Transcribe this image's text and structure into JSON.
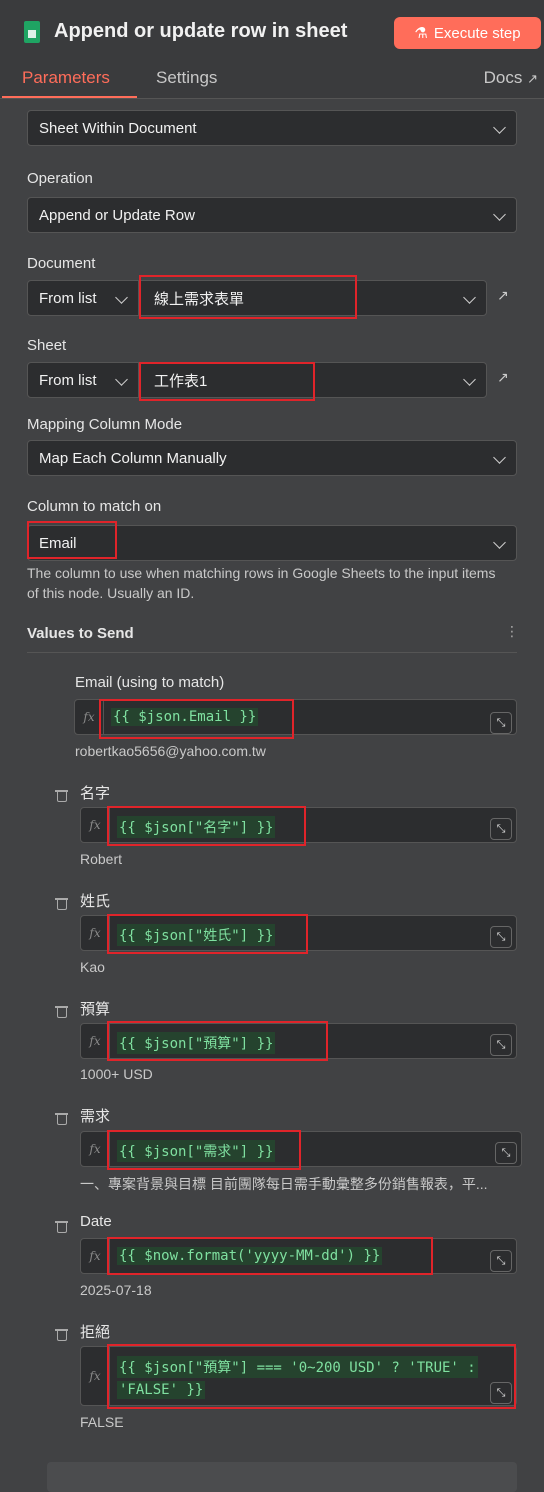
{
  "header": {
    "title": "Append or update row in sheet",
    "execute_label": "Execute step",
    "icon": "google-sheets-icon"
  },
  "tabs": {
    "parameters": "Parameters",
    "settings": "Settings",
    "docs": "Docs"
  },
  "fields": {
    "sheet_within_doc": {
      "value": "Sheet Within Document"
    },
    "operation": {
      "label": "Operation",
      "value": "Append or Update Row"
    },
    "document": {
      "label": "Document",
      "mode": "From list",
      "value": "線上需求表單"
    },
    "sheet": {
      "label": "Sheet",
      "mode": "From list",
      "value": "工作表1"
    },
    "mapping_mode": {
      "label": "Mapping Column Mode",
      "value": "Map Each Column Manually"
    },
    "column_match": {
      "label": "Column to match on",
      "value": "Email",
      "hint": "The column to use when matching rows in Google Sheets to the input items of this node. Usually an ID."
    }
  },
  "values_section": {
    "title": "Values to Send",
    "items": [
      {
        "label": "Email (using to match)",
        "expr": "{{ $json.Email }}",
        "result": "robertkao5656@yahoo.com.tw"
      },
      {
        "label": "名字",
        "expr": "{{ $json[\"名字\"] }}",
        "result": "Robert"
      },
      {
        "label": "姓氏",
        "expr": "{{ $json[\"姓氏\"] }}",
        "result": "Kao"
      },
      {
        "label": "預算",
        "expr": "{{ $json[\"預算\"] }}",
        "result": "1000+ USD"
      },
      {
        "label": "需求",
        "expr": "{{ $json[\"需求\"] }}",
        "result": "一、專案背景與目標 目前團隊每日需手動彙整多份銷售報表，平..."
      },
      {
        "label": "Date",
        "expr": "{{ $now.format('yyyy-MM-dd') }}",
        "result": "2025-07-18"
      },
      {
        "label": "拒絕",
        "expr_line1": "{{ $json[\"預算\"] === '0~200 USD' ? 'TRUE' :",
        "expr_line2": "'FALSE' }}",
        "result": "FALSE"
      }
    ]
  },
  "colors": {
    "accent": "#ff6d5a",
    "highlight": "#e0242a",
    "code_text": "#7fe0a0"
  }
}
